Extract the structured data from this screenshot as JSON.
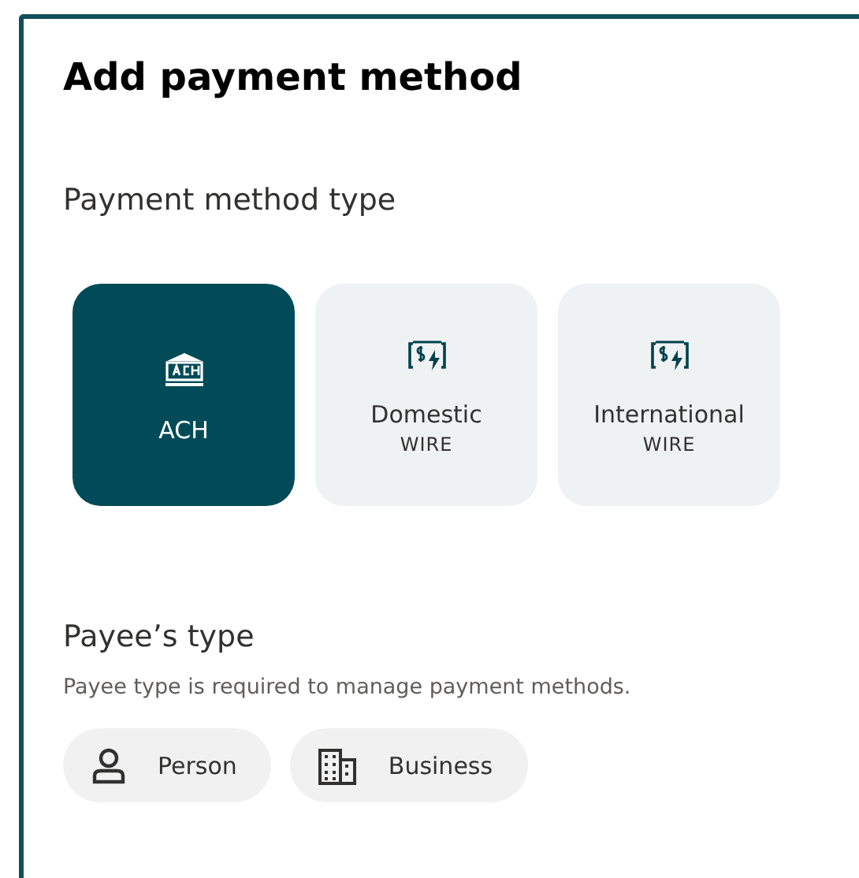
{
  "title": "Add payment method",
  "method_type": {
    "label": "Payment method type",
    "options": [
      {
        "kind": "bank",
        "label": "ACH",
        "selected": true
      },
      {
        "kind": "wire",
        "label": "Domestic",
        "sublabel": "WIRE",
        "selected": false
      },
      {
        "kind": "wire",
        "label": "International",
        "sublabel": "WIRE",
        "selected": false
      }
    ]
  },
  "payee_type": {
    "label": "Payee’s type",
    "description": "Payee type is required to manage payment methods.",
    "options": [
      {
        "kind": "person",
        "label": "Person",
        "selected": false
      },
      {
        "kind": "building",
        "label": "Business",
        "selected": false
      }
    ]
  }
}
